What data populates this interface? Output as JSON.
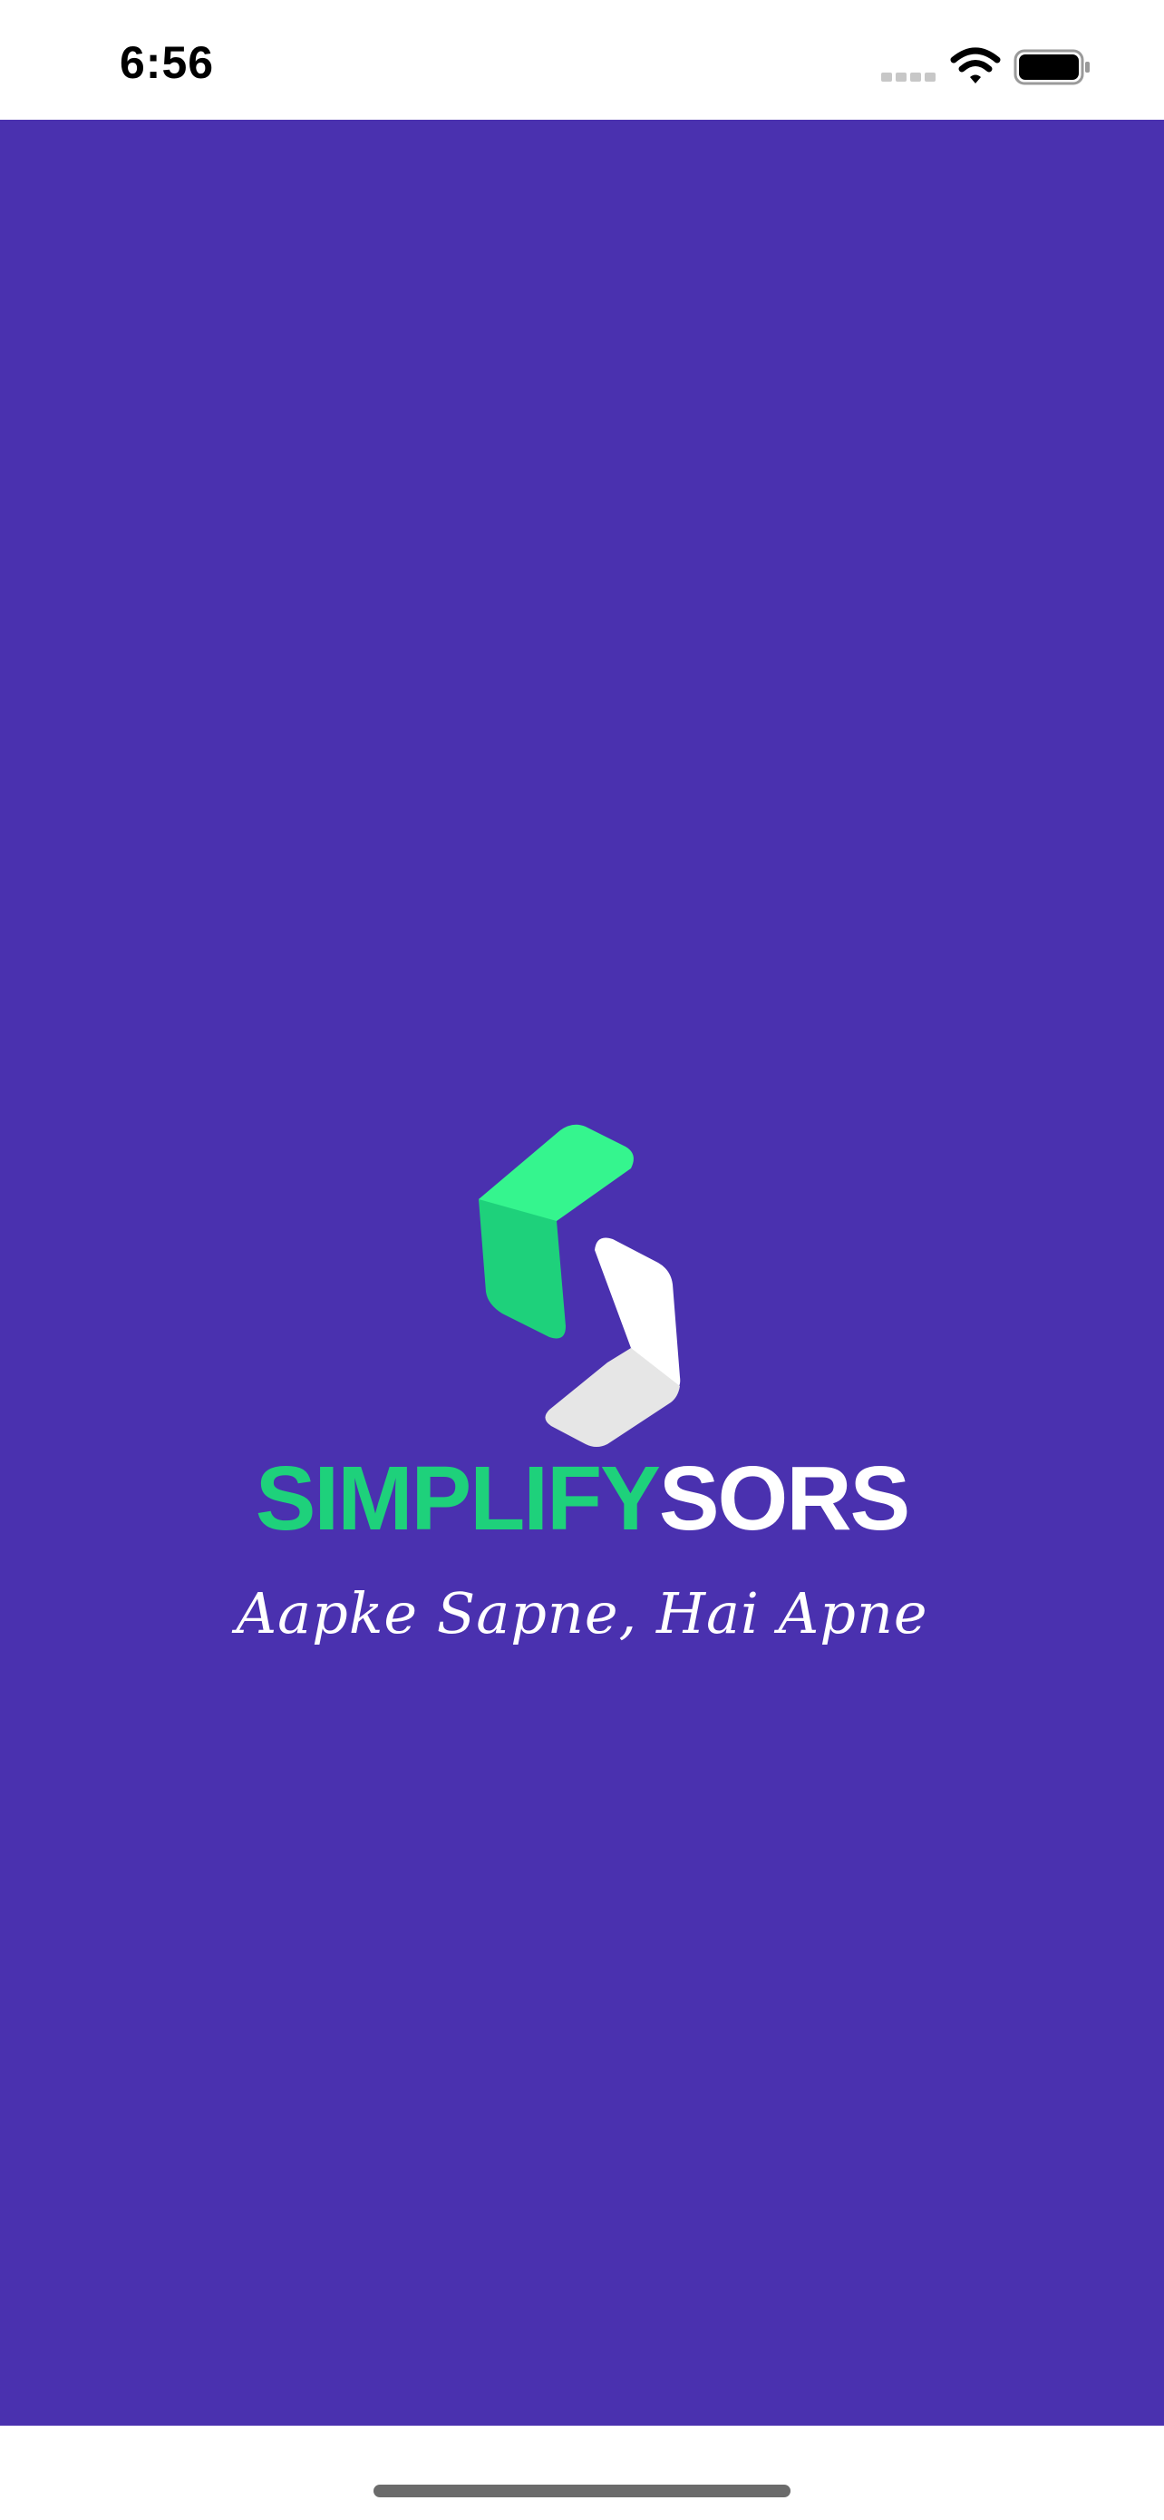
{
  "status_bar": {
    "time": "6:56",
    "icons": [
      "signal-icon",
      "wifi-icon",
      "battery-icon"
    ]
  },
  "splash": {
    "background_color": "#4A31AF",
    "brand": {
      "part1": "SIMPLIFY",
      "part2": "SORS",
      "part1_color": "#1ED17B",
      "part2_color": "#FFFFFF"
    },
    "tagline": "Aapke Sapne, Hai Apne",
    "logo_icon": "simplifysors-logo-icon"
  }
}
